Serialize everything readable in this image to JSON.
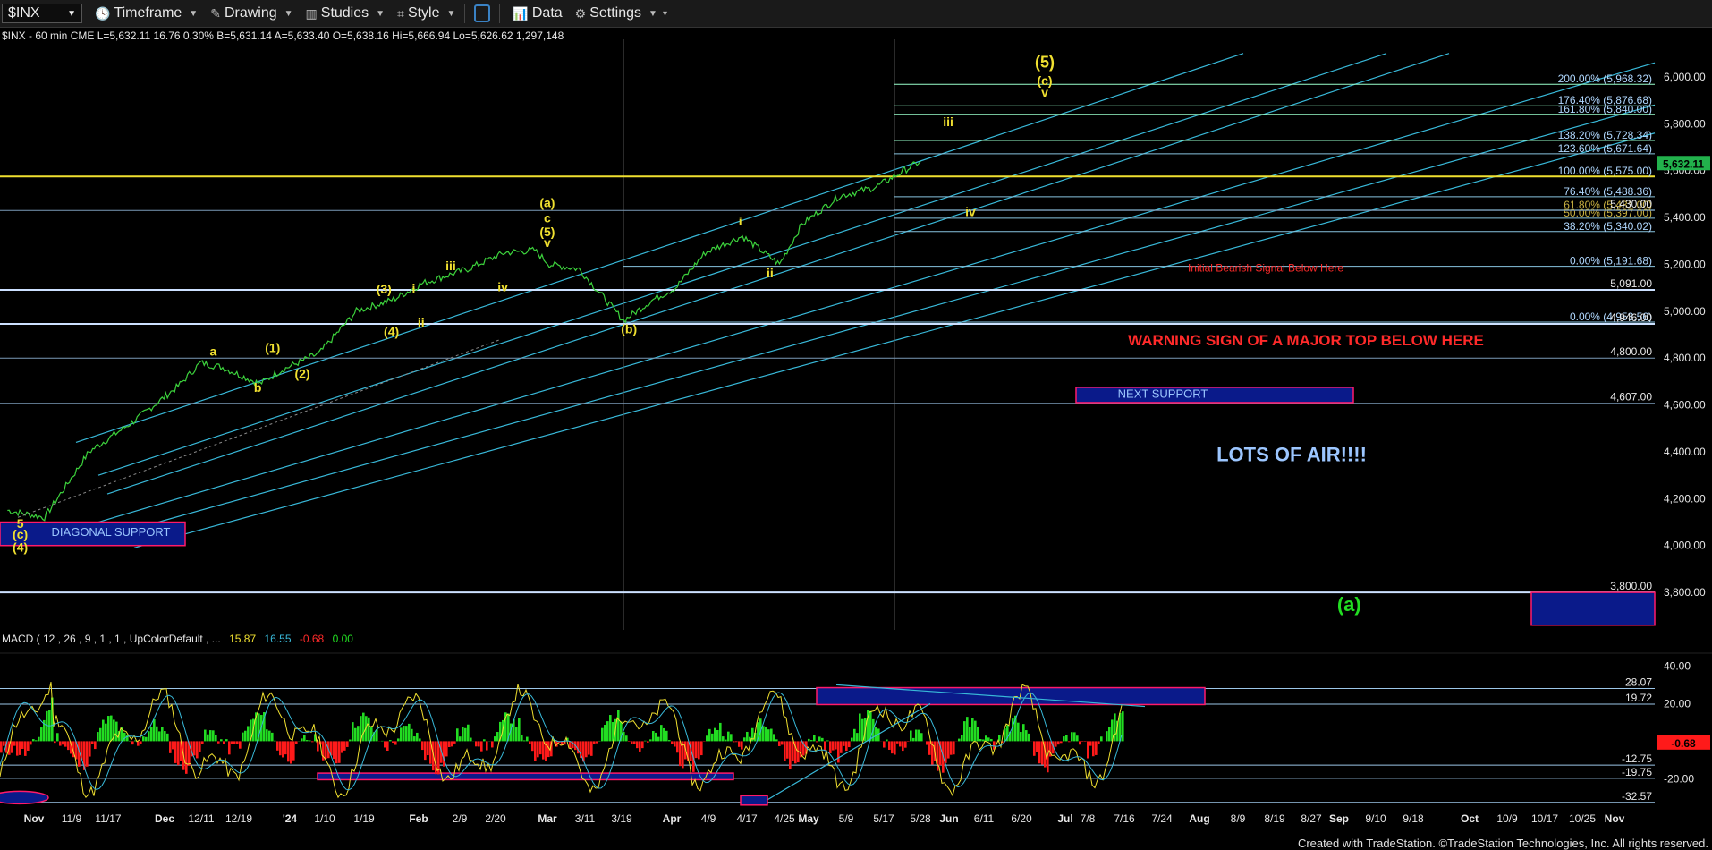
{
  "toolbar": {
    "symbol": "$INX",
    "items": [
      {
        "name": "timeframe-button",
        "label": "Timeframe",
        "icon": "clock-icon"
      },
      {
        "name": "drawing-button",
        "label": "Drawing",
        "icon": "pencil-icon"
      },
      {
        "name": "studies-button",
        "label": "Studies",
        "icon": "chart-bars-icon"
      },
      {
        "name": "style-button",
        "label": "Style",
        "icon": "style-icon"
      },
      {
        "name": "data-button",
        "label": "Data",
        "icon": "data-icon"
      },
      {
        "name": "settings-button",
        "label": "Settings",
        "icon": "gear-icon"
      }
    ]
  },
  "quote_line": "$INX - 60 min CME  L=5,632.11  16.76  0.30%  B=5,631.14  A=5,633.40  O=5,638.16  Hi=5,666.94  Lo=5,626.62  1,297,148",
  "macd_header": {
    "label": "MACD ( 12 , 26 , 9 , 1 , 1 , UpColorDefault , ...",
    "v1": "15.87",
    "v2": "16.55",
    "v3": "-0.68",
    "v4": "0.00"
  },
  "credit": "Created with TradeStation. ©TradeStation Technologies, Inc. All rights reserved.",
  "colors": {
    "price": "#3cd13c",
    "yellow": "#f0e030",
    "cyan": "#38b8d8",
    "label_blue": "#9cc6ff",
    "red": "#ff2a2a",
    "macd_hist_up": "#22dd22",
    "macd_hist_down": "#ff1a1a",
    "navy": "#0a1a8a"
  },
  "chart_data": {
    "type": "line",
    "title": "",
    "symbol": "$INX",
    "interval": "60 min",
    "x_ticks": [
      "Nov",
      "11/9",
      "11/17",
      "Dec",
      "12/11",
      "12/19",
      "'24",
      "1/10",
      "1/19",
      "Feb",
      "2/9",
      "2/20",
      "Mar",
      "3/11",
      "3/19",
      "Apr",
      "4/9",
      "4/17",
      "4/25",
      "May",
      "5/9",
      "5/17",
      "5/28",
      "Jun",
      "6/11",
      "6/20",
      "Jul",
      "7/8",
      "7/16",
      "7/24",
      "Aug",
      "8/9",
      "8/19",
      "8/27",
      "Sep",
      "9/10",
      "9/18",
      "Oct",
      "10/9",
      "10/17",
      "10/25",
      "Nov"
    ],
    "price_axis": {
      "ylim": [
        3640,
        6160
      ],
      "ticks": [
        3800,
        4000,
        4200,
        4400,
        4600,
        4800,
        5000,
        5200,
        5400,
        5600,
        5800,
        6000
      ],
      "tick_labels": [
        "3,800.00",
        "4,000.00",
        "4,200.00",
        "4,400.00",
        "4,600.00",
        "4,800.00",
        "5,000.00",
        "5,200.00",
        "5,400.00",
        "5,600.00",
        "5,800.00",
        "6,000.00"
      ]
    },
    "price_series": {
      "name": "$INX",
      "x": [
        1,
        6,
        12,
        18,
        24,
        27,
        30,
        35,
        38,
        43,
        48,
        53,
        57,
        63,
        68,
        72,
        74,
        78,
        84,
        88,
        91,
        95,
        100,
        105,
        108,
        113,
        118,
        124
      ],
      "y": [
        4150,
        4120,
        4400,
        4530,
        4680,
        4780,
        4760,
        4690,
        4750,
        4820,
        5000,
        5050,
        5120,
        5180,
        5250,
        5260,
        5200,
        5180,
        4960,
        5050,
        5100,
        5250,
        5320,
        5200,
        5370,
        5490,
        5530,
        5640
      ],
      "last": "5,632.11"
    },
    "horizontal_levels": [
      {
        "value": 5968.32,
        "label": "200.00% (5,968.32)"
      },
      {
        "value": 5876.68,
        "label": "176.40% (5,876.68)"
      },
      {
        "value": 5840.0,
        "label": "161.80% (5,840.00)"
      },
      {
        "value": 5728.34,
        "label": "138.20% (5,728.34)"
      },
      {
        "value": 5671.64,
        "label": "123.60% (5,671.64)"
      },
      {
        "value": 5575.0,
        "label": "100.00% (5,575.00)"
      },
      {
        "value": 5488.36,
        "label": "76.40% (5,488.36)"
      },
      {
        "value": 5431.0,
        "label": "61.80% (5,431.00)"
      },
      {
        "value": 5397.0,
        "label": "50.00% (5,397.00)"
      },
      {
        "value": 5340.02,
        "label": "38.20% (5,340.02)"
      },
      {
        "value": 5191.68,
        "label": "0.00% (5,191.68)"
      },
      {
        "value": 4953.56,
        "label": "0.00% (4,953.56)"
      }
    ],
    "price_levels": [
      {
        "value": 5430.0,
        "label": "5,430.00"
      },
      {
        "value": 5091.0,
        "label": "5,091.00"
      },
      {
        "value": 4946.0,
        "label": "4,946.00"
      },
      {
        "value": 4800.0,
        "label": "4,800.00"
      },
      {
        "value": 4607.0,
        "label": "4,607.00"
      },
      {
        "value": 3800.0,
        "label": "3,800.00"
      }
    ],
    "annotations": [
      {
        "text": "WARNING SIGN OF A MAJOR TOP BELOW HERE",
        "color": "red"
      },
      {
        "text": "Initial Bearish Signal Below Here",
        "color": "red"
      },
      {
        "text": "NEXT SUPPORT",
        "color": "box"
      },
      {
        "text": "DIAGONAL SUPPORT",
        "color": "box"
      },
      {
        "text": "LOTS OF AIR!!!!",
        "color": "blue"
      }
    ],
    "wave_labels": [
      {
        "text": "(5)",
        "x": 140,
        "y": 6040
      },
      {
        "text": "(c)",
        "x": 140,
        "y": 5965
      },
      {
        "text": "v",
        "x": 140,
        "y": 5915
      },
      {
        "text": "iii",
        "x": 127,
        "y": 5790
      },
      {
        "text": "iv",
        "x": 130,
        "y": 5405
      },
      {
        "text": "(a)",
        "x": 73,
        "y": 5445
      },
      {
        "text": "c",
        "x": 73,
        "y": 5380
      },
      {
        "text": "(5)",
        "x": 73,
        "y": 5320
      },
      {
        "text": "v",
        "x": 73,
        "y": 5275
      },
      {
        "text": "i",
        "x": 99,
        "y": 5365
      },
      {
        "text": "ii",
        "x": 103,
        "y": 5145
      },
      {
        "text": "(b)",
        "x": 84,
        "y": 4905
      },
      {
        "text": "a",
        "x": 28,
        "y": 4810
      },
      {
        "text": "b",
        "x": 34,
        "y": 4655
      },
      {
        "text": "(1)",
        "x": 36,
        "y": 4825
      },
      {
        "text": "(2)",
        "x": 40,
        "y": 4715
      },
      {
        "text": "(3)",
        "x": 51,
        "y": 5075
      },
      {
        "text": "(4)",
        "x": 52,
        "y": 4895
      },
      {
        "text": "iii",
        "x": 60,
        "y": 5175
      },
      {
        "text": "iv",
        "x": 67,
        "y": 5085
      },
      {
        "text": "i",
        "x": 55,
        "y": 5080
      },
      {
        "text": "ii",
        "x": 56,
        "y": 4935
      },
      {
        "text": "5",
        "x": 2,
        "y": 4075
      },
      {
        "text": "(c)",
        "x": 2,
        "y": 4030
      },
      {
        "text": "(4)",
        "x": 2,
        "y": 3975
      },
      {
        "text": "(a)",
        "x": 181,
        "y": 3720
      }
    ],
    "macd": {
      "ylim": [
        -36,
        44
      ],
      "ticks": [
        40,
        20,
        -20
      ],
      "tick_labels": [
        "40.00",
        "20.00",
        "-20.00"
      ],
      "levels": [
        {
          "value": 28.07,
          "label": "28.07"
        },
        {
          "value": 19.72,
          "label": "19.72"
        },
        {
          "value": -12.75,
          "label": "-12.75"
        },
        {
          "value": -19.75,
          "label": "-19.75"
        },
        {
          "value": -32.57,
          "label": "-32.57"
        }
      ],
      "last": "-0.68"
    }
  }
}
